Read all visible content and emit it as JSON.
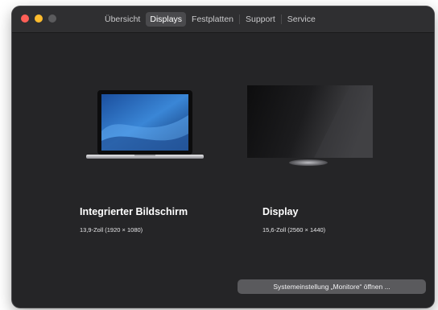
{
  "tabs": [
    "Übersicht",
    "Displays",
    "Festplatten",
    "Support",
    "Service"
  ],
  "active_tab": "Displays",
  "displays": [
    {
      "name": "Integrierter Bildschirm",
      "resolution": "13,9-Zoll (1920 × 1080)",
      "icon": "laptop-icon"
    },
    {
      "name": "Display",
      "resolution": "15,6-Zoll (2560 × 1440)",
      "icon": "monitor-icon"
    }
  ],
  "open_settings_button": "Systemeinstellung „Monitore“ öffnen ...",
  "colors": {
    "window_bg": "#252527",
    "close": "#ff5f57",
    "minimize": "#febc2e",
    "button": "#5a5a5d"
  }
}
